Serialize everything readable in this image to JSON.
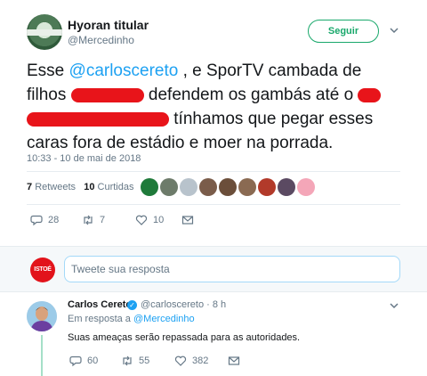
{
  "header": {
    "name": "Hyoran titular",
    "handle": "@Mercedinho",
    "follow_label": "Seguir"
  },
  "tweet": {
    "text_1": "Esse ",
    "mention": "@carloscereto",
    "text_2": " , e SporTV cambada de filhos ",
    "text_3": " defendem os gambás até o ",
    "text_4": " tínhamos que pegar esses caras fora de estádio e moer na porrada.",
    "timestamp": "10:33 - 10 de mai de 2018",
    "retweets_count": "7",
    "retweets_label": "Retweets",
    "likes_count": "10",
    "likes_label": "Curtidas",
    "reply_count": "28",
    "retweet_action_count": "7",
    "like_action_count": "10"
  },
  "likers": [
    {
      "icon": "palmeiras-avatar",
      "color": "#1f7a3a"
    },
    {
      "icon": "photo-avatar",
      "color": "#6d7b6a"
    },
    {
      "icon": "default-avatar",
      "color": "#b8c3cc"
    },
    {
      "icon": "photo-avatar",
      "color": "#7a5c4a"
    },
    {
      "icon": "photo-avatar",
      "color": "#6b4e3a"
    },
    {
      "icon": "photo-avatar",
      "color": "#8a6a52"
    },
    {
      "icon": "photo-avatar",
      "color": "#b23a2a"
    },
    {
      "icon": "photo-avatar",
      "color": "#5b4a62"
    },
    {
      "icon": "pig-avatar",
      "color": "#f4a6b8"
    }
  ],
  "reply_box": {
    "avatar_text": "ISTOÉ",
    "placeholder": "Tweete sua resposta"
  },
  "reply": {
    "name": "Carlos Cereto",
    "handle_time": "@carloscereto · 8 h",
    "in_reply_prefix": "Em resposta a ",
    "in_reply_mention": "@Mercedinho",
    "text": "Suas ameaças serão repassada para as autoridades.",
    "reply_count": "60",
    "retweet_count": "55",
    "like_count": "382"
  },
  "colors": {
    "accent": "#1da1f2",
    "follow": "#19a86b",
    "redaction": "#e8141a"
  }
}
